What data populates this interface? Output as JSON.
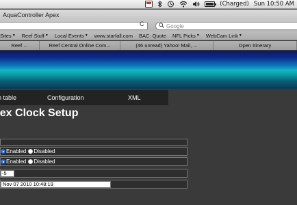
{
  "menubar": {
    "status": "(Charged)",
    "clock": "Sun 10:50 AM",
    "icons": [
      "app-status-icon",
      "bluetooth-icon",
      "time-machine-icon",
      "wifi-icon",
      "volume-icon",
      "battery-icon"
    ]
  },
  "window": {
    "title": "AquaController Apex"
  },
  "toolbar": {
    "search_placeholder": "Google",
    "reload_glyph": "C"
  },
  "bookmarks": [
    "Sites",
    "Reef Stuff",
    "Local Events",
    "www.starfall.com",
    "BAC: Quote",
    "NFL Picks",
    "WebCam Link"
  ],
  "bookmark_has_menu": [
    true,
    true,
    true,
    false,
    false,
    true,
    true
  ],
  "tabs": [
    "Reef ...",
    "Reef Central Online Com...",
    "(46 unread) Yahoo! Mail, ...",
    "Open Itinerary"
  ],
  "nav": {
    "items": [
      "n table",
      "Configuration",
      "XML"
    ]
  },
  "page": {
    "title": "pex Clock Setup"
  },
  "form": {
    "row1_option_enabled": "Enabled",
    "row1_option_disabled": "Disabled",
    "row1_selected": "Enabled",
    "row2_option_enabled": "Enabled",
    "row2_option_disabled": "Disabled",
    "row2_selected": "Enabled",
    "timezone_value": "-5",
    "datetime_value": "Nov 07 2010 10:48:19"
  },
  "colors": {
    "page_background": "#3a3a3a",
    "navbar": "#232323",
    "banner_top": "#10185c",
    "banner_mid": "#12b6c3",
    "radio_selected": "#2d7ff2"
  }
}
